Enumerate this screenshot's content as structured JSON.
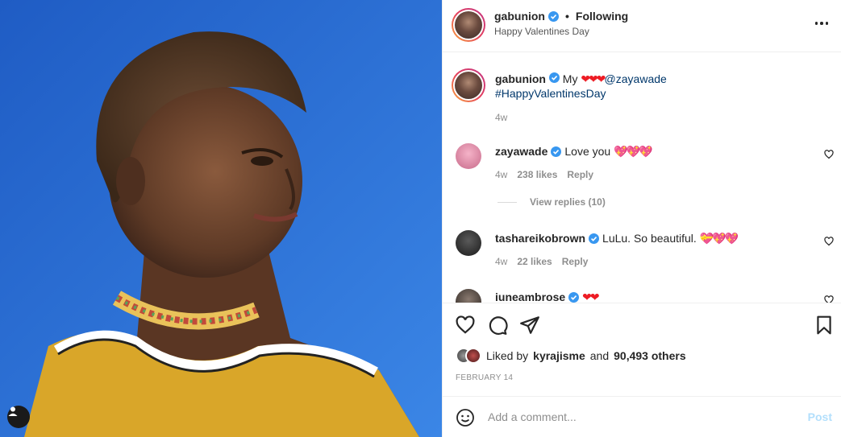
{
  "colors": {
    "accent": "#0095f6",
    "link": "#00376b",
    "verified": "#3897f0",
    "muted": "#8e8e8e",
    "sky": "#2a6fd6"
  },
  "header": {
    "username": "gabunion",
    "separator": "•",
    "follow_status": "Following",
    "subtitle": "Happy Valentines Day"
  },
  "caption": {
    "username": "gabunion",
    "text": "My",
    "emoji": "❤❤❤",
    "mention": "@zayawade",
    "hashtag": "#HappyValentinesDay",
    "time": "4w"
  },
  "comments": [
    {
      "username": "zayawade",
      "text": "Love you",
      "emoji": "💖💖💖",
      "time": "4w",
      "likes": "238 likes",
      "reply": "Reply",
      "view_replies": "View replies (10)"
    },
    {
      "username": "tashareikobrown",
      "text": "LuLu. So beautiful.",
      "emoji": "💝💖💖",
      "time": "4w",
      "likes": "22 likes",
      "reply": "Reply"
    },
    {
      "username": "iuneambrose",
      "emoji": "❤❤"
    }
  ],
  "likes": {
    "prefix": "Liked by",
    "user": "kyrajisme",
    "and": "and",
    "others": "90,493 others"
  },
  "date": "FEBRUARY 14",
  "add_comment": {
    "placeholder": "Add a comment...",
    "post_label": "Post"
  },
  "icons": [
    "heart-icon",
    "comment-icon",
    "share-icon",
    "bookmark-icon",
    "emoji-icon",
    "more-icon",
    "verified-icon",
    "user-tag-icon"
  ]
}
